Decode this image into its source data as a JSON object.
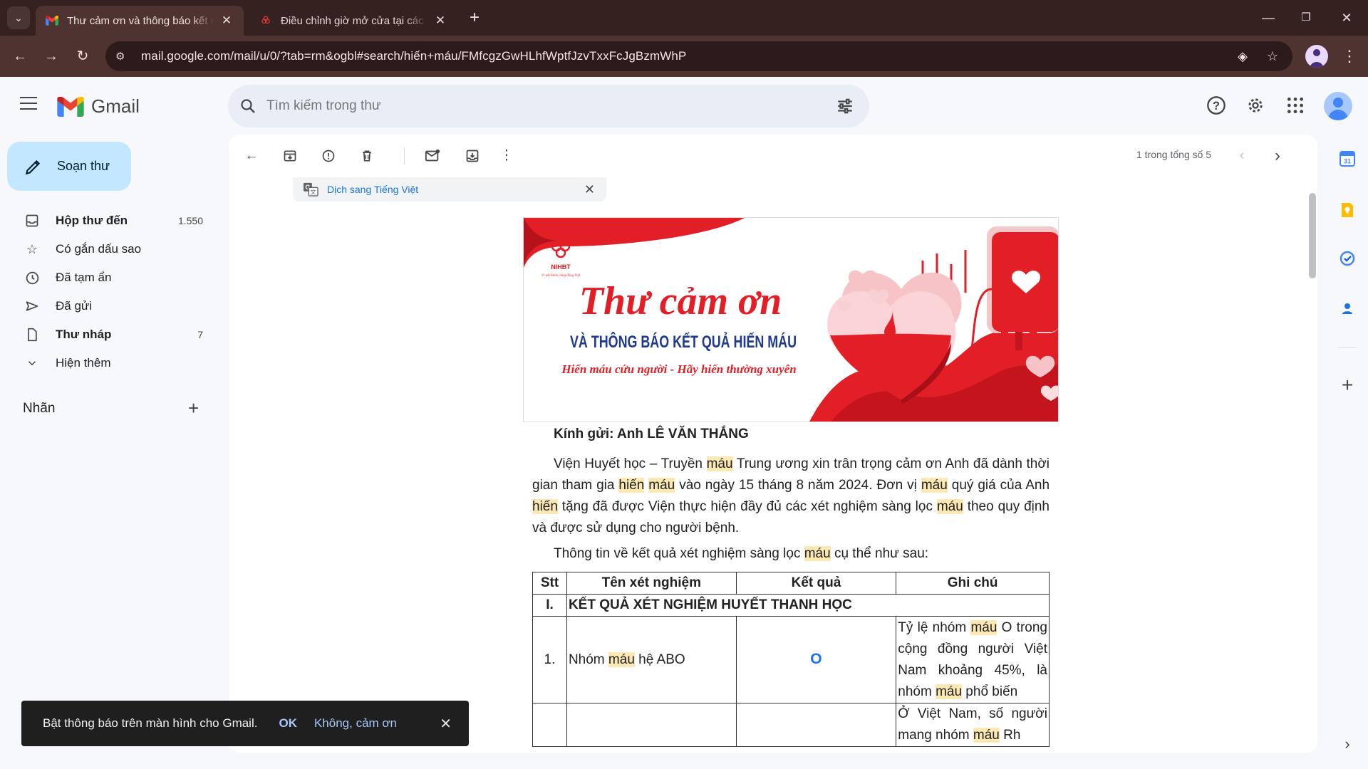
{
  "browser": {
    "tabs": [
      {
        "title": "Thư cảm ơn và thông báo kết quả hiến máu",
        "active": true
      },
      {
        "title": "Điều chỉnh giờ mở cửa tại các điểm hiến máu",
        "active": false
      }
    ],
    "url": "mail.google.com/mail/u/0/?tab=rm&ogbl#search/hiến+máu/FMfcgzGwHLhfWptfJzvTxxFcJgBzmWhP"
  },
  "gmail": {
    "brand": "Gmail",
    "search_placeholder": "Tìm kiếm trong thư",
    "compose_label": "Soạn thư",
    "nav": [
      {
        "label": "Hộp thư đến",
        "count": "1.550",
        "icon": "inbox-icon",
        "bold": true
      },
      {
        "label": "Có gắn dấu sao",
        "count": "",
        "icon": "star-icon",
        "bold": false
      },
      {
        "label": "Đã tạm ẩn",
        "count": "",
        "icon": "clock-icon",
        "bold": false
      },
      {
        "label": "Đã gửi",
        "count": "",
        "icon": "send-icon",
        "bold": false
      },
      {
        "label": "Thư nháp",
        "count": "7",
        "icon": "draft-icon",
        "bold": true
      },
      {
        "label": "Hiện thêm",
        "count": "",
        "icon": "chevron-down-icon",
        "bold": false
      }
    ],
    "labels_title": "Nhãn",
    "pager_text": "1 trong tổng số 5",
    "translate_link": "Dịch sang Tiếng Việt"
  },
  "banner": {
    "logo_text": "NIHBT",
    "logo_tagline": "Vì sức khỏe cộng đồng Việt",
    "title_script": "Thư cảm ơn",
    "title_main": "VÀ THÔNG BÁO KẾT QUẢ HIẾN MÁU",
    "slogan": "Hiến máu cứu người - Hãy hiến thường xuyên"
  },
  "email": {
    "greeting": "Kính gửi: Anh LÊ VĂN THẮNG",
    "p1": [
      {
        "t": "Viện Huyết học – Truyền ",
        "h": false
      },
      {
        "t": "máu",
        "h": true
      },
      {
        "t": " Trung ương xin trân trọng cảm ơn Anh đã dành thời gian tham gia ",
        "h": false
      },
      {
        "t": "hiến",
        "h": true
      },
      {
        "t": " ",
        "h": false
      },
      {
        "t": "máu",
        "h": true
      },
      {
        "t": " vào ngày 15 tháng 8 năm 2024. Đơn vị ",
        "h": false
      },
      {
        "t": "máu",
        "h": true
      },
      {
        "t": " quý giá của Anh ",
        "h": false
      },
      {
        "t": "hiến",
        "h": true
      },
      {
        "t": " tặng đã được Viện thực hiện đầy đủ các xét nghiệm sàng lọc ",
        "h": false
      },
      {
        "t": "máu",
        "h": true
      },
      {
        "t": " theo quy định và được sử dụng cho người bệnh.",
        "h": false
      }
    ],
    "p2": [
      {
        "t": "Thông tin về kết quả xét nghiệm sàng lọc ",
        "h": false
      },
      {
        "t": "máu",
        "h": true
      },
      {
        "t": " cụ thể như sau:",
        "h": false
      }
    ],
    "table": {
      "headers": [
        "Stt",
        "Tên xét nghiệm",
        "Kết quả",
        "Ghi chú"
      ],
      "section_stt": "I.",
      "section_title": "KẾT QUẢ XÉT NGHIỆM HUYẾT THANH HỌC",
      "row1_stt": "1.",
      "row1_name": [
        {
          "t": "Nhóm ",
          "h": false
        },
        {
          "t": "máu",
          "h": true
        },
        {
          "t": " hệ ABO",
          "h": false
        }
      ],
      "row1_result": "O",
      "row1_note": [
        {
          "t": "Tỷ lệ nhóm ",
          "h": false
        },
        {
          "t": "máu",
          "h": true
        },
        {
          "t": " O trong cộng đồng người Việt Nam khoảng 45%, là nhóm ",
          "h": false
        },
        {
          "t": "máu",
          "h": true
        },
        {
          "t": " phổ biến",
          "h": false
        }
      ],
      "row2_note": [
        {
          "t": "Ở Việt Nam, số người mang nhóm ",
          "h": false
        },
        {
          "t": "máu",
          "h": true
        },
        {
          "t": " Rh",
          "h": false
        }
      ]
    }
  },
  "snackbar": {
    "message": "Bật thông báo trên màn hình cho Gmail.",
    "ok": "OK",
    "no": "Không, cảm ơn"
  }
}
